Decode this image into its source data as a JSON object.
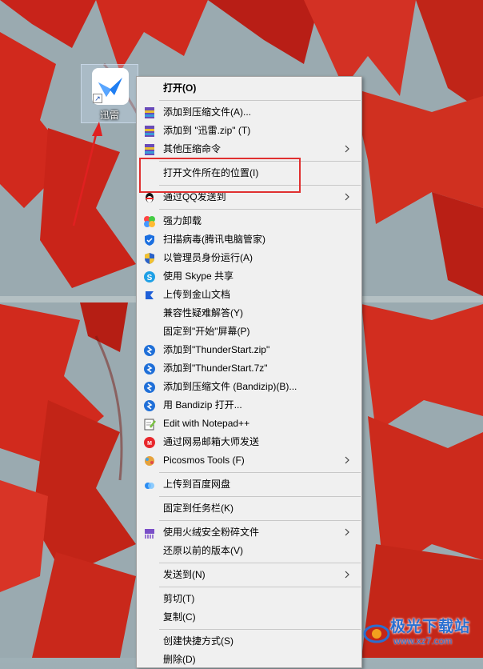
{
  "desktop": {
    "shortcut_label": "迅雷"
  },
  "context_menu": {
    "items": [
      {
        "label": "打开(O)",
        "icon": "none",
        "bold": true
      },
      {
        "label": "添加到压缩文件(A)...",
        "icon": "winrar-archive-icon"
      },
      {
        "label": "添加到 \"迅雷.zip\" (T)",
        "icon": "winrar-archive-icon"
      },
      {
        "label": "其他压缩命令",
        "icon": "winrar-archive-icon",
        "submenu": true
      },
      {
        "label": "打开文件所在的位置(I)",
        "icon": "none"
      },
      {
        "label": "通过QQ发送到",
        "icon": "qq-penguin-icon",
        "submenu": true
      },
      {
        "label": "强力卸载",
        "icon": "pinwheel-icon"
      },
      {
        "label": "扫描病毒(腾讯电脑管家)",
        "icon": "tencent-shield-icon"
      },
      {
        "label": "以管理员身份运行(A)",
        "icon": "uac-shield-icon"
      },
      {
        "label": "使用 Skype 共享",
        "icon": "skype-icon"
      },
      {
        "label": "上传到金山文档",
        "icon": "kingsoft-docs-icon"
      },
      {
        "label": "兼容性疑难解答(Y)",
        "icon": "none"
      },
      {
        "label": "固定到\"开始\"屏幕(P)",
        "icon": "none"
      },
      {
        "label": "添加到\"ThunderStart.zip\"",
        "icon": "bandizip-icon"
      },
      {
        "label": "添加到\"ThunderStart.7z\"",
        "icon": "bandizip-icon"
      },
      {
        "label": "添加到压缩文件 (Bandizip)(B)...",
        "icon": "bandizip-icon"
      },
      {
        "label": "用 Bandizip 打开...",
        "icon": "bandizip-icon"
      },
      {
        "label": "Edit with Notepad++",
        "icon": "notepad-plus-plus-icon"
      },
      {
        "label": "通过网易邮箱大师发送",
        "icon": "netease-mail-icon"
      },
      {
        "label": "Picosmos Tools (F)",
        "icon": "picosmos-icon",
        "submenu": true
      },
      {
        "label": "上传到百度网盘",
        "icon": "baidu-netdisk-icon"
      },
      {
        "label": "固定到任务栏(K)",
        "icon": "none"
      },
      {
        "label": "使用火绒安全粉碎文件",
        "icon": "huorong-shredder-icon",
        "submenu": true
      },
      {
        "label": "还原以前的版本(V)",
        "icon": "none"
      },
      {
        "label": "发送到(N)",
        "icon": "none",
        "submenu": true
      },
      {
        "label": "剪切(T)",
        "icon": "none"
      },
      {
        "label": "复制(C)",
        "icon": "none"
      },
      {
        "label": "创建快捷方式(S)",
        "icon": "none"
      },
      {
        "label": "删除(D)",
        "icon": "none"
      }
    ]
  },
  "watermark": {
    "title": "极光下载站",
    "url": "www.xz7.com"
  },
  "colors": {
    "highlight": "#e03030",
    "menu_bg": "#f0f0f0",
    "watermark": "#2a6fd0"
  }
}
